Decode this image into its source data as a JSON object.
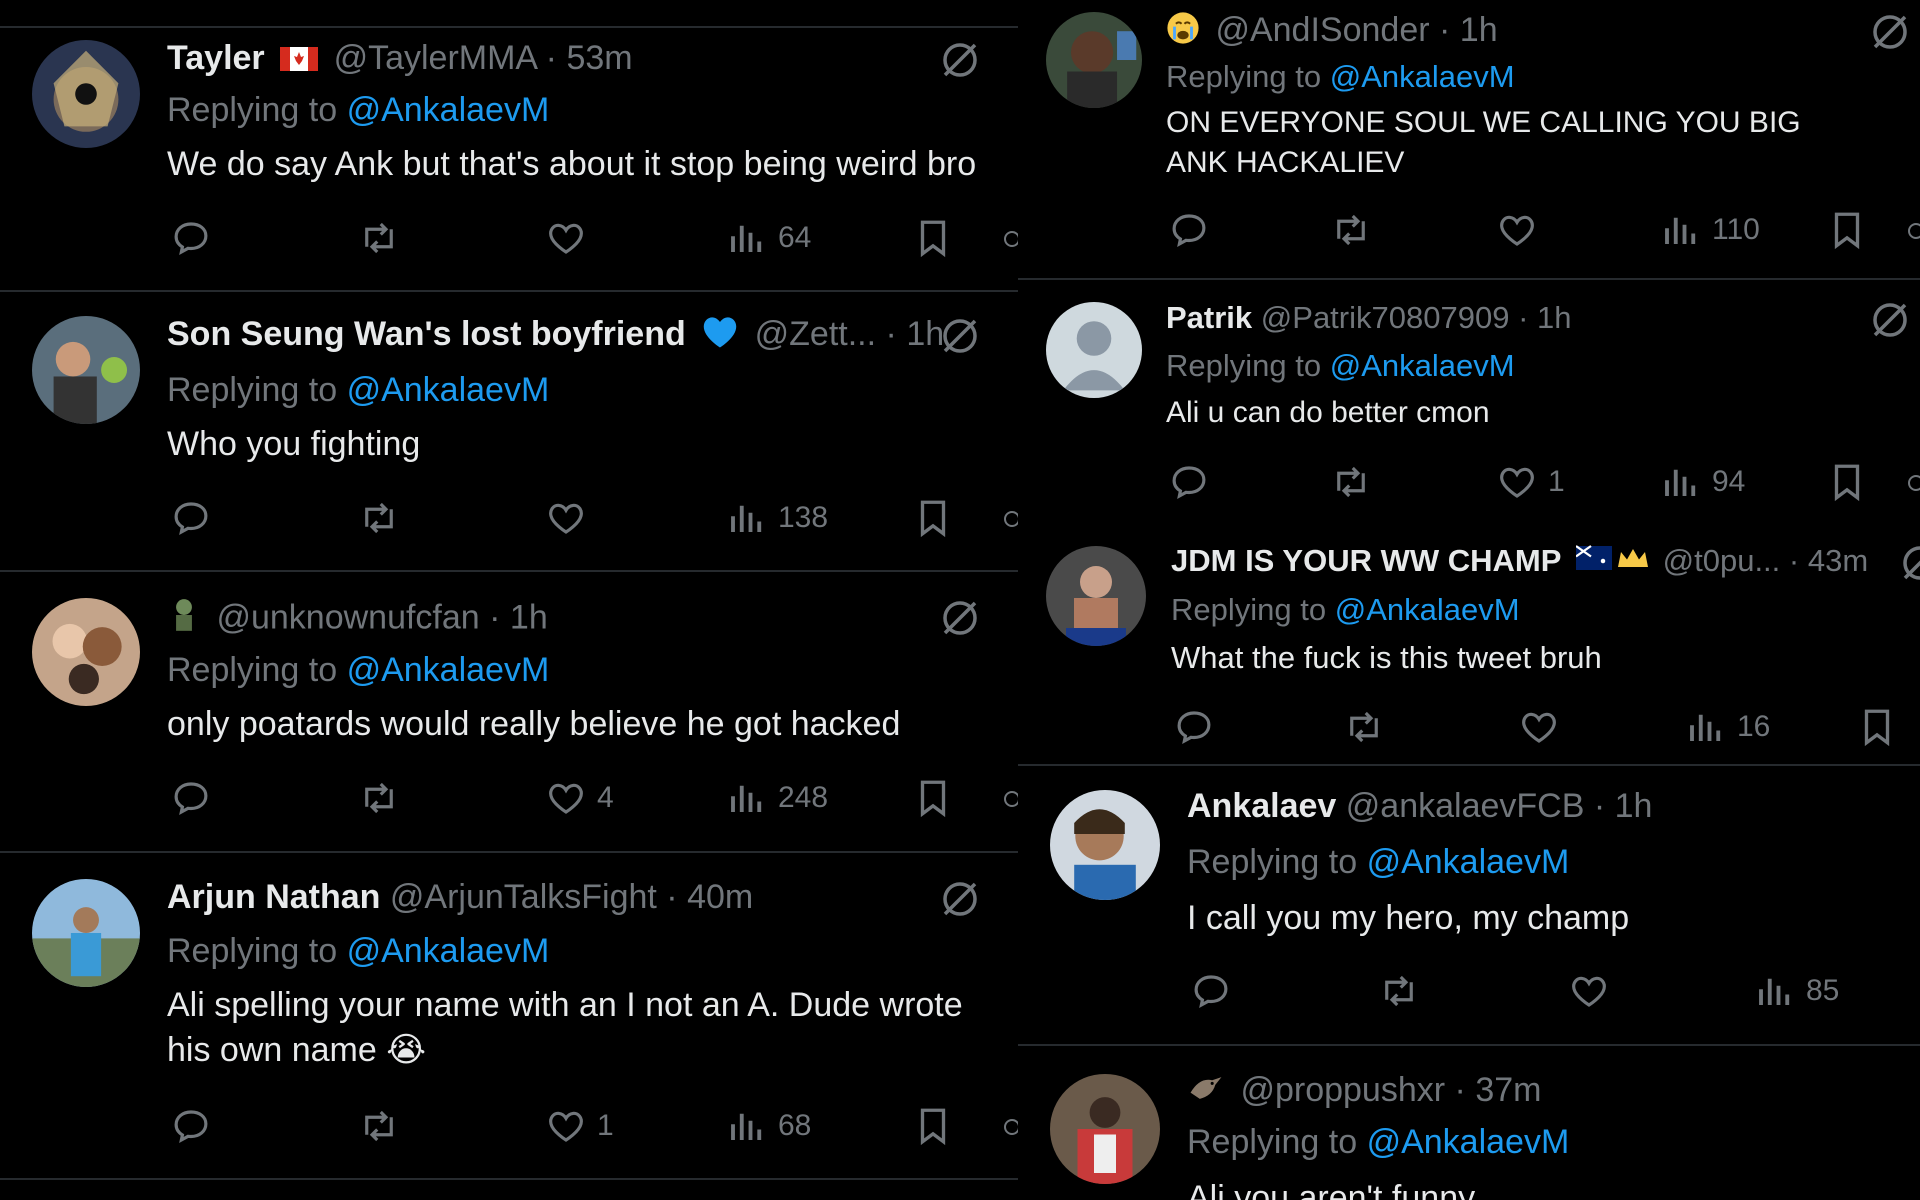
{
  "left": [
    {
      "name": "Tayler",
      "badge": "canada-flag",
      "handle": "@TaylerMMA",
      "sep": "·",
      "time": "53m",
      "replying_prefix": "Replying to",
      "replying_to": "@AnkalaevM",
      "text": "We do say Ank but that's about it stop being weird bro",
      "likes": "",
      "views": "64"
    },
    {
      "name": "Son Seung Wan's lost boyfriend",
      "badge": "blue-heart",
      "handle": "@Zett...",
      "sep": "·",
      "time": "1h",
      "replying_prefix": "Replying to",
      "replying_to": "@AnkalaevM",
      "text": "Who you fighting",
      "likes": "",
      "views": "138"
    },
    {
      "name": "",
      "badge": "goblin-emoji",
      "handle": "@unknownufcfan",
      "sep": "·",
      "time": "1h",
      "replying_prefix": "Replying to",
      "replying_to": "@AnkalaevM",
      "text": "only poatards would really believe he got hacked",
      "likes": "4",
      "views": "248"
    },
    {
      "name": "Arjun Nathan",
      "badge": "",
      "handle": "@ArjunTalksFight",
      "sep": "·",
      "time": "40m",
      "replying_prefix": "Replying to",
      "replying_to": "@AnkalaevM",
      "text": "Ali spelling your name with an I not an A. Dude wrote his own name 😭",
      "likes": "1",
      "views": "68"
    }
  ],
  "right": [
    {
      "name": "",
      "badge": "crying-emoji",
      "handle": "@AndISonder",
      "sep": "·",
      "time": "1h",
      "replying_prefix": "Replying to",
      "replying_to": "@AnkalaevM",
      "text": "ON EVERYONE SOUL WE CALLING YOU BIG ANK HACKALIEV",
      "likes": "",
      "views": "110"
    },
    {
      "name": "Patrik",
      "badge": "",
      "handle": "@Patrik70807909",
      "sep": "·",
      "time": "1h",
      "replying_prefix": "Replying to",
      "replying_to": "@AnkalaevM",
      "text": "Ali u can do better cmon",
      "likes": "1",
      "views": "94"
    },
    {
      "name": "JDM IS YOUR WW CHAMP",
      "badge": "australia-flag-crown",
      "handle": "@t0pu...",
      "sep": "·",
      "time": "43m",
      "replying_prefix": "Replying to",
      "replying_to": "@AnkalaevM",
      "text": "What the fuck is this tweet bruh",
      "likes": "",
      "views": "16"
    },
    {
      "name": "Ankalaev",
      "badge": "",
      "handle": "@ankalaevFCB",
      "sep": "·",
      "time": "1h",
      "replying_prefix": "Replying to",
      "replying_to": "@AnkalaevM",
      "text": "I call you my hero, my champ",
      "likes": "",
      "views": "85"
    },
    {
      "name": "",
      "badge": "bird-emoji",
      "handle": "@proppushxr",
      "sep": "·",
      "time": "37m",
      "replying_prefix": "Replying to",
      "replying_to": "@AnkalaevM",
      "text": "Ali you aren't funny",
      "likes": "",
      "views": ""
    }
  ],
  "colors": {
    "background": "#000000",
    "text": "#e7e9ea",
    "muted": "#71767b",
    "mention": "#1d9bf0",
    "divider": "#262a2e"
  },
  "icons": [
    "reply-icon",
    "repost-icon",
    "like-icon",
    "views-icon",
    "bookmark-icon",
    "grok-icon"
  ]
}
